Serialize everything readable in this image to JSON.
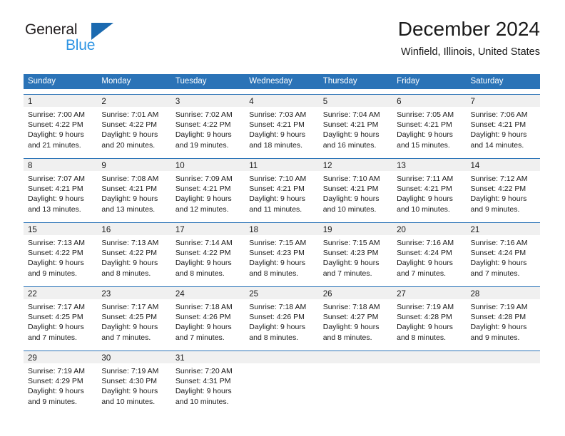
{
  "brand": {
    "name_part1": "General",
    "name_part2": "Blue",
    "triangle_icon": "triangle-icon",
    "color_dark": "#231f20",
    "color_blue": "#2e94e3",
    "color_triangle": "#1b6ab0"
  },
  "header": {
    "title": "December 2024",
    "location": "Winfield, Illinois, United States"
  },
  "calendar": {
    "accent_color": "#2b73b7",
    "band_color": "#f0f0f0",
    "weekdays": [
      "Sunday",
      "Monday",
      "Tuesday",
      "Wednesday",
      "Thursday",
      "Friday",
      "Saturday"
    ],
    "weeks": [
      [
        {
          "day": "1",
          "sunrise": "Sunrise: 7:00 AM",
          "sunset": "Sunset: 4:22 PM",
          "daylight1": "Daylight: 9 hours",
          "daylight2": "and 21 minutes."
        },
        {
          "day": "2",
          "sunrise": "Sunrise: 7:01 AM",
          "sunset": "Sunset: 4:22 PM",
          "daylight1": "Daylight: 9 hours",
          "daylight2": "and 20 minutes."
        },
        {
          "day": "3",
          "sunrise": "Sunrise: 7:02 AM",
          "sunset": "Sunset: 4:22 PM",
          "daylight1": "Daylight: 9 hours",
          "daylight2": "and 19 minutes."
        },
        {
          "day": "4",
          "sunrise": "Sunrise: 7:03 AM",
          "sunset": "Sunset: 4:21 PM",
          "daylight1": "Daylight: 9 hours",
          "daylight2": "and 18 minutes."
        },
        {
          "day": "5",
          "sunrise": "Sunrise: 7:04 AM",
          "sunset": "Sunset: 4:21 PM",
          "daylight1": "Daylight: 9 hours",
          "daylight2": "and 16 minutes."
        },
        {
          "day": "6",
          "sunrise": "Sunrise: 7:05 AM",
          "sunset": "Sunset: 4:21 PM",
          "daylight1": "Daylight: 9 hours",
          "daylight2": "and 15 minutes."
        },
        {
          "day": "7",
          "sunrise": "Sunrise: 7:06 AM",
          "sunset": "Sunset: 4:21 PM",
          "daylight1": "Daylight: 9 hours",
          "daylight2": "and 14 minutes."
        }
      ],
      [
        {
          "day": "8",
          "sunrise": "Sunrise: 7:07 AM",
          "sunset": "Sunset: 4:21 PM",
          "daylight1": "Daylight: 9 hours",
          "daylight2": "and 13 minutes."
        },
        {
          "day": "9",
          "sunrise": "Sunrise: 7:08 AM",
          "sunset": "Sunset: 4:21 PM",
          "daylight1": "Daylight: 9 hours",
          "daylight2": "and 13 minutes."
        },
        {
          "day": "10",
          "sunrise": "Sunrise: 7:09 AM",
          "sunset": "Sunset: 4:21 PM",
          "daylight1": "Daylight: 9 hours",
          "daylight2": "and 12 minutes."
        },
        {
          "day": "11",
          "sunrise": "Sunrise: 7:10 AM",
          "sunset": "Sunset: 4:21 PM",
          "daylight1": "Daylight: 9 hours",
          "daylight2": "and 11 minutes."
        },
        {
          "day": "12",
          "sunrise": "Sunrise: 7:10 AM",
          "sunset": "Sunset: 4:21 PM",
          "daylight1": "Daylight: 9 hours",
          "daylight2": "and 10 minutes."
        },
        {
          "day": "13",
          "sunrise": "Sunrise: 7:11 AM",
          "sunset": "Sunset: 4:21 PM",
          "daylight1": "Daylight: 9 hours",
          "daylight2": "and 10 minutes."
        },
        {
          "day": "14",
          "sunrise": "Sunrise: 7:12 AM",
          "sunset": "Sunset: 4:22 PM",
          "daylight1": "Daylight: 9 hours",
          "daylight2": "and 9 minutes."
        }
      ],
      [
        {
          "day": "15",
          "sunrise": "Sunrise: 7:13 AM",
          "sunset": "Sunset: 4:22 PM",
          "daylight1": "Daylight: 9 hours",
          "daylight2": "and 9 minutes."
        },
        {
          "day": "16",
          "sunrise": "Sunrise: 7:13 AM",
          "sunset": "Sunset: 4:22 PM",
          "daylight1": "Daylight: 9 hours",
          "daylight2": "and 8 minutes."
        },
        {
          "day": "17",
          "sunrise": "Sunrise: 7:14 AM",
          "sunset": "Sunset: 4:22 PM",
          "daylight1": "Daylight: 9 hours",
          "daylight2": "and 8 minutes."
        },
        {
          "day": "18",
          "sunrise": "Sunrise: 7:15 AM",
          "sunset": "Sunset: 4:23 PM",
          "daylight1": "Daylight: 9 hours",
          "daylight2": "and 8 minutes."
        },
        {
          "day": "19",
          "sunrise": "Sunrise: 7:15 AM",
          "sunset": "Sunset: 4:23 PM",
          "daylight1": "Daylight: 9 hours",
          "daylight2": "and 7 minutes."
        },
        {
          "day": "20",
          "sunrise": "Sunrise: 7:16 AM",
          "sunset": "Sunset: 4:24 PM",
          "daylight1": "Daylight: 9 hours",
          "daylight2": "and 7 minutes."
        },
        {
          "day": "21",
          "sunrise": "Sunrise: 7:16 AM",
          "sunset": "Sunset: 4:24 PM",
          "daylight1": "Daylight: 9 hours",
          "daylight2": "and 7 minutes."
        }
      ],
      [
        {
          "day": "22",
          "sunrise": "Sunrise: 7:17 AM",
          "sunset": "Sunset: 4:25 PM",
          "daylight1": "Daylight: 9 hours",
          "daylight2": "and 7 minutes."
        },
        {
          "day": "23",
          "sunrise": "Sunrise: 7:17 AM",
          "sunset": "Sunset: 4:25 PM",
          "daylight1": "Daylight: 9 hours",
          "daylight2": "and 7 minutes."
        },
        {
          "day": "24",
          "sunrise": "Sunrise: 7:18 AM",
          "sunset": "Sunset: 4:26 PM",
          "daylight1": "Daylight: 9 hours",
          "daylight2": "and 7 minutes."
        },
        {
          "day": "25",
          "sunrise": "Sunrise: 7:18 AM",
          "sunset": "Sunset: 4:26 PM",
          "daylight1": "Daylight: 9 hours",
          "daylight2": "and 8 minutes."
        },
        {
          "day": "26",
          "sunrise": "Sunrise: 7:18 AM",
          "sunset": "Sunset: 4:27 PM",
          "daylight1": "Daylight: 9 hours",
          "daylight2": "and 8 minutes."
        },
        {
          "day": "27",
          "sunrise": "Sunrise: 7:19 AM",
          "sunset": "Sunset: 4:28 PM",
          "daylight1": "Daylight: 9 hours",
          "daylight2": "and 8 minutes."
        },
        {
          "day": "28",
          "sunrise": "Sunrise: 7:19 AM",
          "sunset": "Sunset: 4:28 PM",
          "daylight1": "Daylight: 9 hours",
          "daylight2": "and 9 minutes."
        }
      ],
      [
        {
          "day": "29",
          "sunrise": "Sunrise: 7:19 AM",
          "sunset": "Sunset: 4:29 PM",
          "daylight1": "Daylight: 9 hours",
          "daylight2": "and 9 minutes."
        },
        {
          "day": "30",
          "sunrise": "Sunrise: 7:19 AM",
          "sunset": "Sunset: 4:30 PM",
          "daylight1": "Daylight: 9 hours",
          "daylight2": "and 10 minutes."
        },
        {
          "day": "31",
          "sunrise": "Sunrise: 7:20 AM",
          "sunset": "Sunset: 4:31 PM",
          "daylight1": "Daylight: 9 hours",
          "daylight2": "and 10 minutes."
        },
        {
          "day": "",
          "sunrise": "",
          "sunset": "",
          "daylight1": "",
          "daylight2": ""
        },
        {
          "day": "",
          "sunrise": "",
          "sunset": "",
          "daylight1": "",
          "daylight2": ""
        },
        {
          "day": "",
          "sunrise": "",
          "sunset": "",
          "daylight1": "",
          "daylight2": ""
        },
        {
          "day": "",
          "sunrise": "",
          "sunset": "",
          "daylight1": "",
          "daylight2": ""
        }
      ]
    ]
  }
}
